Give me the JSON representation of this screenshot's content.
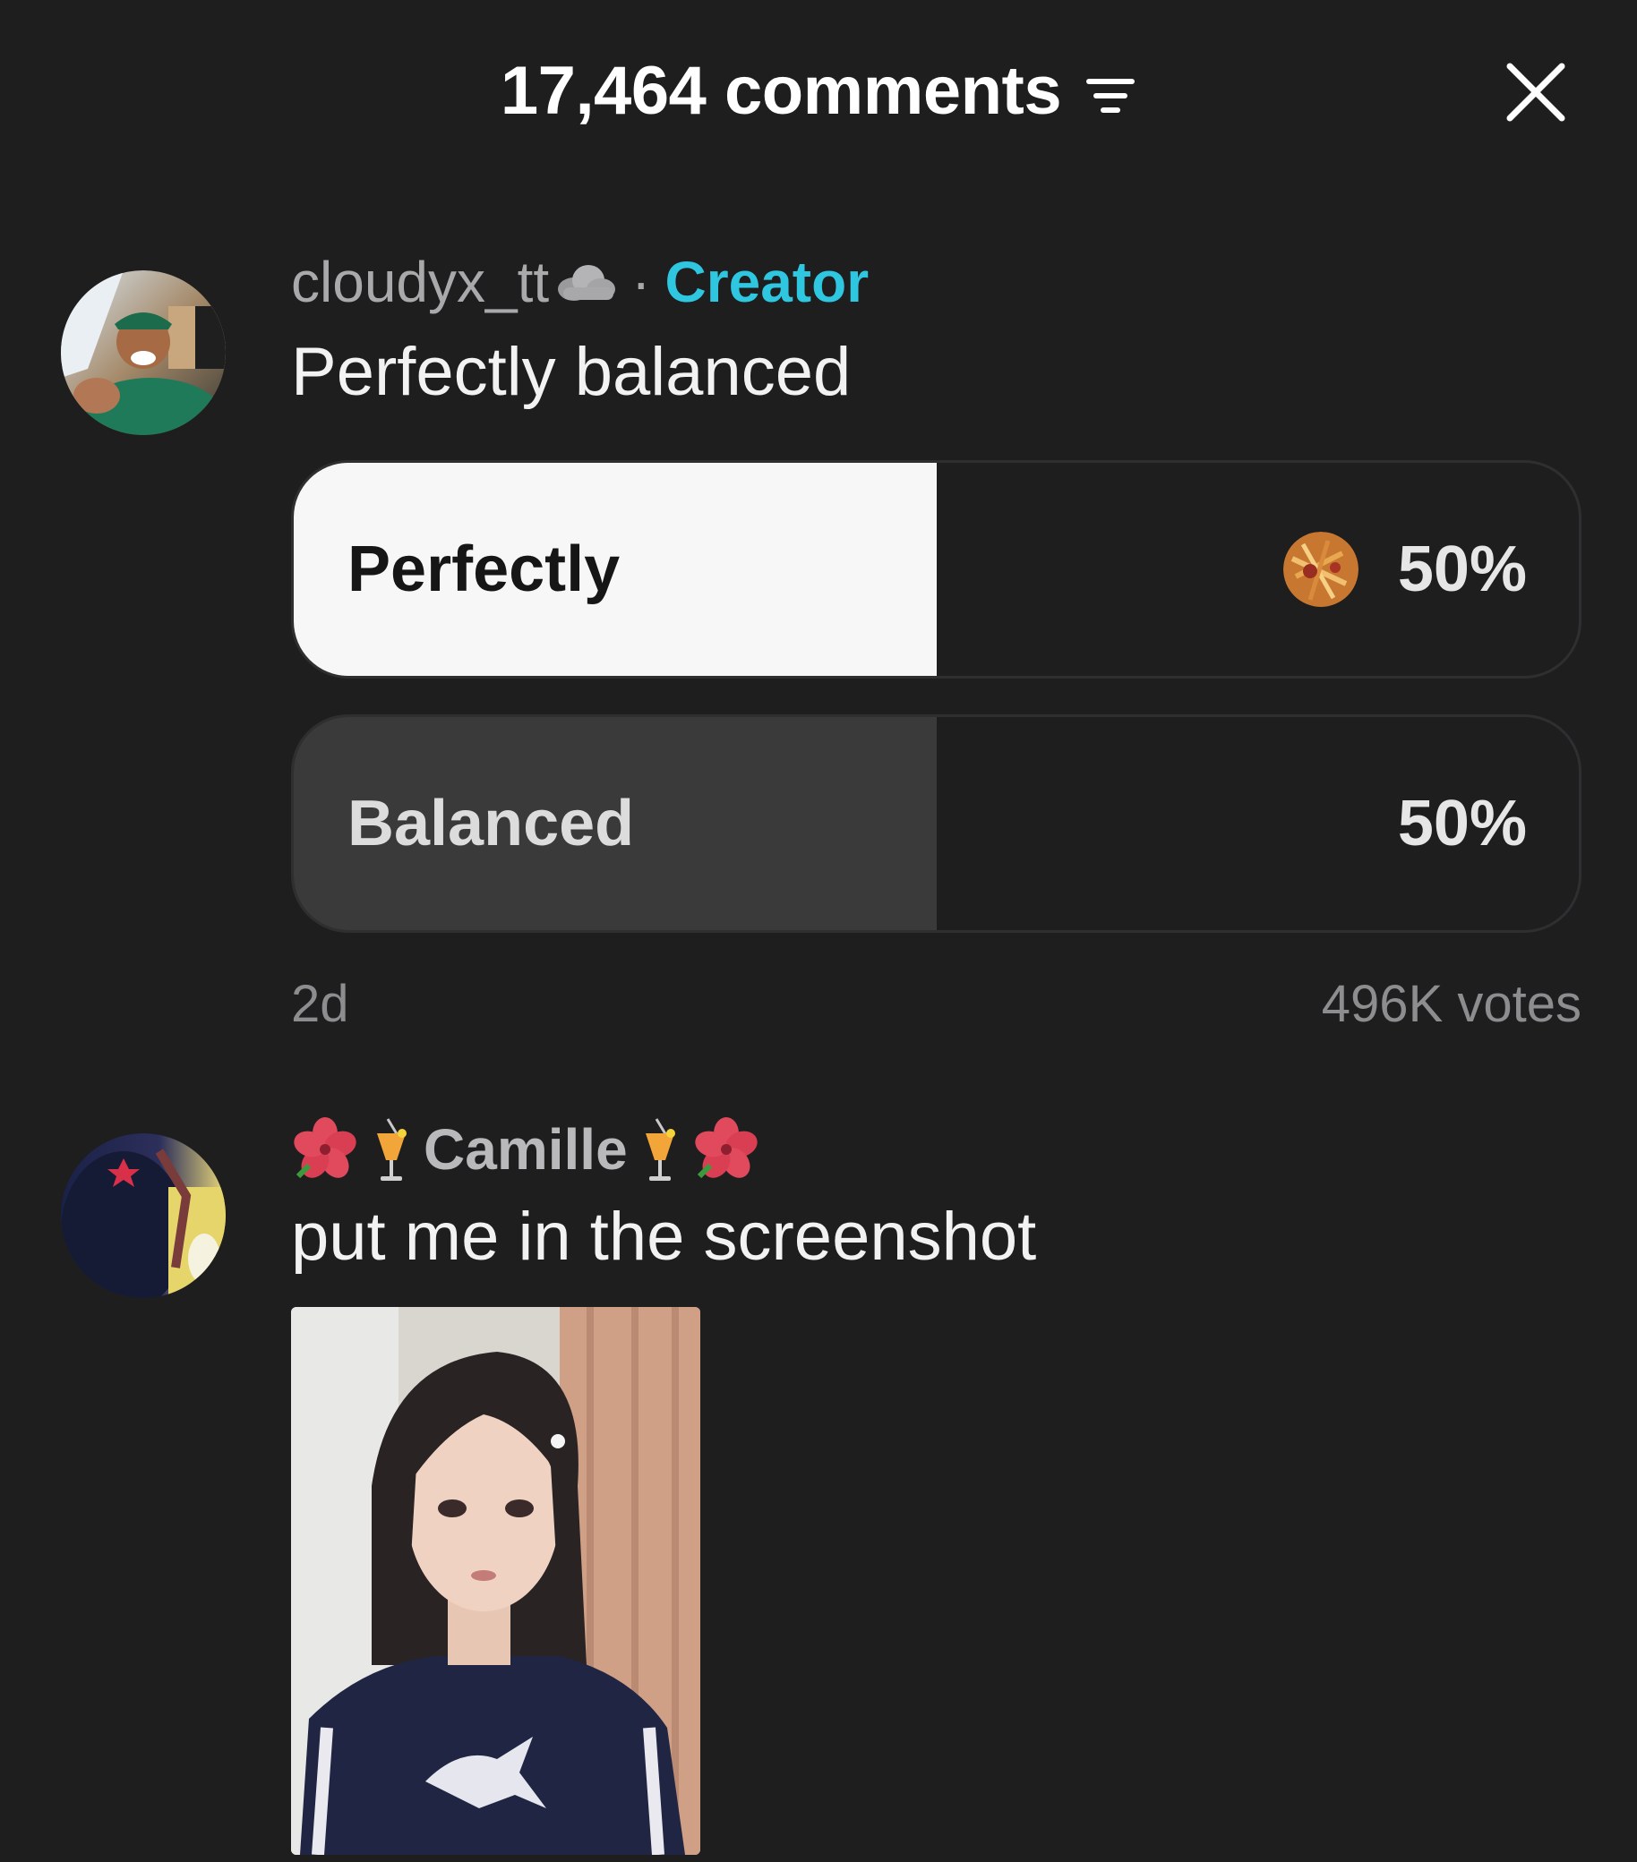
{
  "header": {
    "comment_count": "17,464 comments",
    "filter_icon": "filter-icon",
    "close_icon": "close-icon"
  },
  "poll_comment": {
    "username": "cloudyx_tt",
    "username_emoji": "cloud",
    "separator": "·",
    "badge": "Creator",
    "text": "Perfectly balanced",
    "options": [
      {
        "label": "Perfectly",
        "percent": "50%",
        "share": 0.5,
        "selected": true
      },
      {
        "label": "Balanced",
        "percent": "50%",
        "share": 0.5,
        "selected": false
      }
    ],
    "age": "2d",
    "votes": "496K votes"
  },
  "reply_comment": {
    "username": "Camille",
    "username_decorations": [
      "hibiscus",
      "tropical-drink"
    ],
    "text": "put me in the screenshot"
  },
  "colors": {
    "background": "#1e1e1f",
    "creator_accent": "#2fc6e0",
    "selected_fill": "#f7f7f7",
    "unselected_fill": "#3a3a3b"
  }
}
